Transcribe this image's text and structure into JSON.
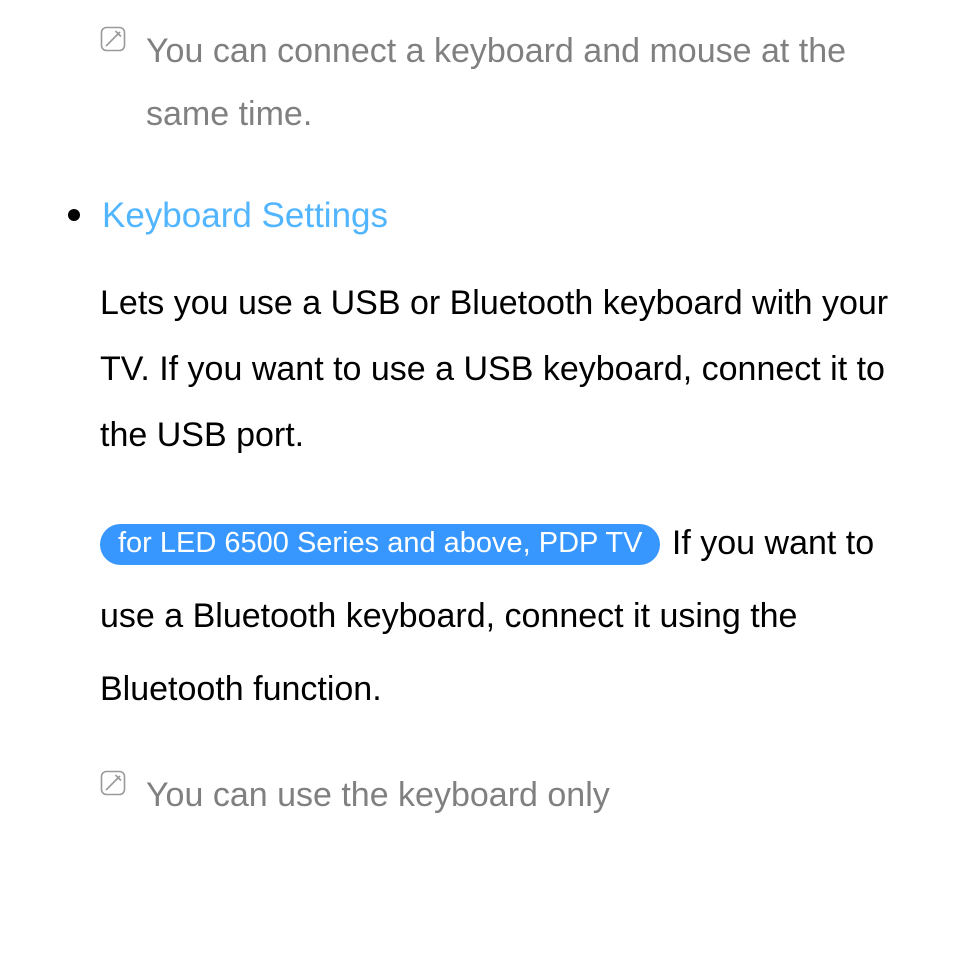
{
  "note1": "You can connect a keyboard and mouse at the same time.",
  "section_title": "Keyboard Settings",
  "paragraph1": "Lets you use a USB or Bluetooth keyboard with your TV. If you want to use a USB keyboard, connect it to the USB port.",
  "pill_text": "for LED 6500 Series and above, PDP TV",
  "paragraph2_after_pill": " If you want to use a Bluetooth keyboard, connect it using the Bluetooth function.",
  "note2": "You can use the keyboard only"
}
